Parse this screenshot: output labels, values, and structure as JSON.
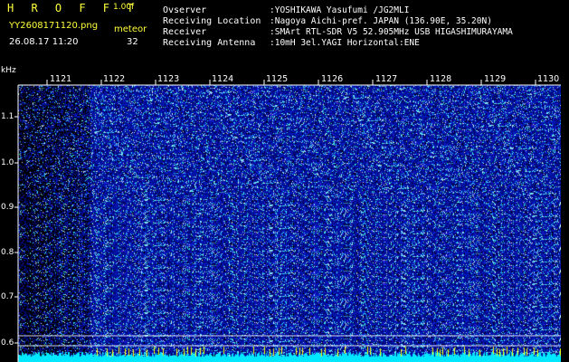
{
  "header": {
    "app_name": "H R O F F T",
    "app_version": "1.00f",
    "file_name": "YY2608171120.png",
    "date_time": "26.08.17 11:20",
    "meteor_label": "meteor",
    "meteor_count": "32",
    "info": [
      {
        "label": "Ovserver",
        "value": ":YOSHIKAWA Yasufumi /JG2MLI"
      },
      {
        "label": "Receiving Location",
        "value": ":Nagoya Aichi-pref. JAPAN (136.90E, 35.20N)"
      },
      {
        "label": "Receiver",
        "value": ":SMArt RTL-SDR V5 52.905MHz USB HIGASHIMURAYAMA"
      },
      {
        "label": "Receiving Antenna",
        "value": ":10mH 3el.YAGI Horizontal:ENE"
      }
    ]
  },
  "axis": {
    "unit": "kHz",
    "y_ticks": [
      "1.1",
      "1.0",
      "0.9",
      "0.8",
      "0.7",
      "0.6"
    ],
    "x_ticks": [
      "1121",
      "1122",
      "1123",
      "1124",
      "1125",
      "1126",
      "1127",
      "1128",
      "1129",
      "1130"
    ]
  },
  "colors": {
    "background": "#000000",
    "header_yellow": "#ffff3a",
    "spectrum_blue": "#0a1cb4",
    "baseline_cyan": "#00e8ff",
    "marker_yellow": "#ffff00"
  }
}
